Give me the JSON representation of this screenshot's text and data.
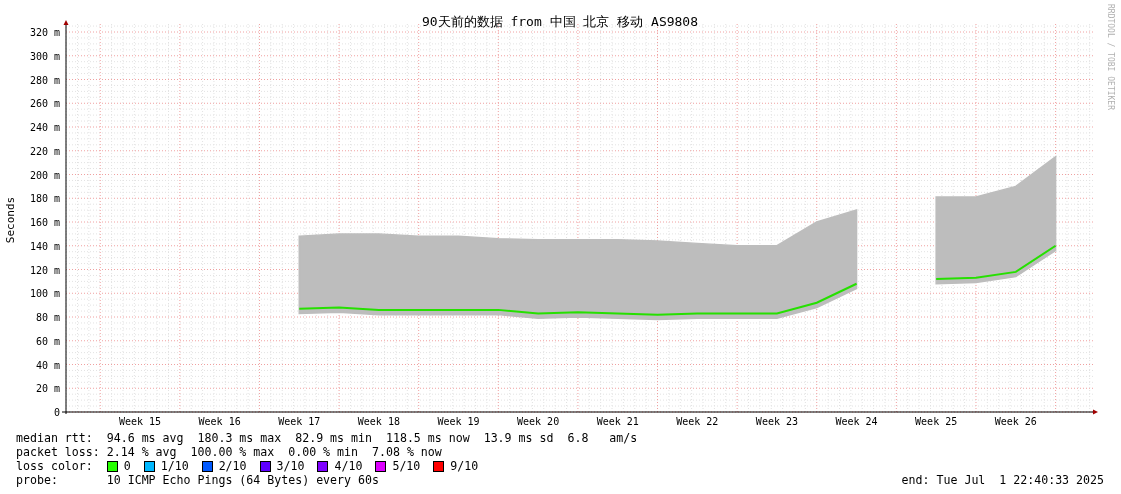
{
  "chart": {
    "credit": "RRDTOOL / TOBI OETIKER",
    "chart_data": {
      "type": "line",
      "title": "90天前的数据 from 中国 北京 移动 AS9808",
      "ylabel": "Seconds",
      "categories": [
        null,
        "Week 15",
        null,
        "Week 16",
        null,
        "Week 17",
        null,
        "Week 18",
        null,
        "Week 19",
        null,
        "Week 20",
        null,
        "Week 21",
        null,
        "Week 22",
        null,
        "Week 23",
        null,
        "Week 24",
        null,
        "Week 25",
        null,
        "Week 26",
        null
      ],
      "ylim": [
        0,
        320
      ],
      "grid": true,
      "yticks": [
        {
          "value": 0,
          "label": "0"
        },
        {
          "value": 20,
          "label": "20 m"
        },
        {
          "value": 40,
          "label": "40 m"
        },
        {
          "value": 60,
          "label": "60 m"
        },
        {
          "value": 80,
          "label": "80 m"
        },
        {
          "value": 100,
          "label": "100 m"
        },
        {
          "value": 120,
          "label": "120 m"
        },
        {
          "value": 140,
          "label": "140 m"
        },
        {
          "value": 160,
          "label": "160 m"
        },
        {
          "value": 180,
          "label": "180 m"
        },
        {
          "value": 200,
          "label": "200 m"
        },
        {
          "value": 220,
          "label": "220 m"
        },
        {
          "value": 240,
          "label": "240 m"
        },
        {
          "value": 260,
          "label": "260 m"
        },
        {
          "value": 280,
          "label": "280 m"
        },
        {
          "value": 300,
          "label": "300 m"
        },
        {
          "value": 320,
          "label": "320 m"
        }
      ],
      "series": [
        {
          "type": "area",
          "color": "#bdbdbd",
          "line_style": "solid",
          "values": [
            null,
            null,
            null,
            null,
            null,
            148,
            150,
            150,
            148,
            148,
            146,
            145,
            145,
            145,
            144,
            142,
            140,
            140,
            160,
            170,
            null,
            181,
            181,
            190,
            215
          ]
        },
        {
          "color": "#26e000",
          "line_style": "solid",
          "values": [
            null,
            null,
            null,
            null,
            null,
            87,
            88,
            86,
            86,
            86,
            86,
            83,
            84,
            83,
            82,
            83,
            83,
            83,
            92,
            108,
            null,
            112,
            113,
            118,
            140
          ]
        }
      ]
    }
  },
  "legend": {
    "rows": [
      {
        "label": "median rtt:",
        "value": "94.6 ms avg  180.3 ms max  82.9 ms min  118.5 ms now  13.9 ms sd  6.8   am/s"
      },
      {
        "label": "packet loss:",
        "value": "2.14 % avg  100.00 % max  0.00 % min  7.08 % now"
      }
    ],
    "loss_color": {
      "label": "loss color:",
      "items": [
        {
          "label": "0",
          "color": "#26ff00"
        },
        {
          "label": "1/10",
          "color": "#00b8ff"
        },
        {
          "label": "2/10",
          "color": "#0059ff"
        },
        {
          "label": "3/10",
          "color": "#5e00ff"
        },
        {
          "label": "4/10",
          "color": "#7e00ff"
        },
        {
          "label": "5/10",
          "color": "#dd00ff"
        },
        {
          "label": "9/10",
          "color": "#ff0000"
        }
      ]
    },
    "probe": {
      "label": "probe:",
      "value": "10 ICMP Echo Pings (64 Bytes) every 60s"
    },
    "end": "end: Tue Jul  1 22:40:33 2025"
  }
}
